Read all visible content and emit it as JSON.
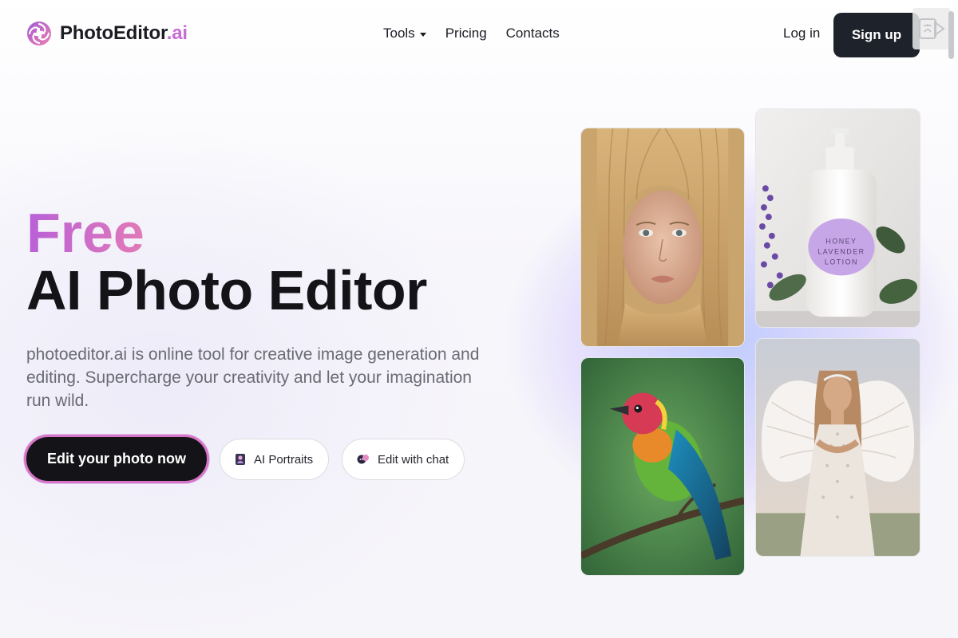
{
  "header": {
    "brand_name": "PhotoEditor",
    "brand_suffix": ".ai",
    "logo_icon": "swirl-logo-icon",
    "nav": [
      {
        "label": "Tools",
        "has_dropdown": true
      },
      {
        "label": "Pricing"
      },
      {
        "label": "Contacts"
      }
    ],
    "login_label": "Log in",
    "signup_label": "Sign up"
  },
  "hero": {
    "free_label": "Free",
    "title": "AI Photo Editor",
    "description": "photoeditor.ai is online tool for creative image generation and editing. Supercharge your creativity and let your imagination run wild.",
    "cta_label": "Edit your photo now",
    "pills": [
      {
        "label": "AI Portraits",
        "icon": "portrait-icon"
      },
      {
        "label": "Edit with chat",
        "icon": "chat-icon"
      }
    ]
  },
  "gallery": {
    "lotion_label_lines": [
      "HONEY",
      "LAVENDER",
      "LOTION"
    ]
  },
  "colors": {
    "accent_gradient_start": "#b860d8",
    "accent_gradient_end": "#e27ab8",
    "dark_button": "#1e222b",
    "text_primary": "#141418",
    "text_muted": "#6a6b74"
  }
}
